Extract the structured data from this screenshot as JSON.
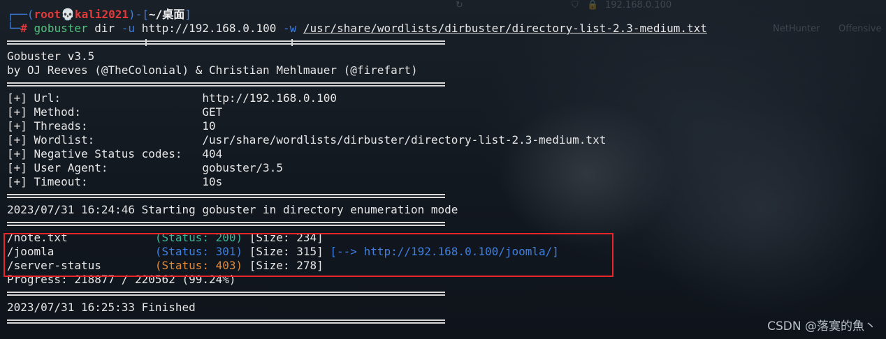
{
  "prompt": {
    "lead1": "┌──(",
    "user": "root",
    "skull": "💀",
    "host": "kali2021",
    "mid": ")-[",
    "cwd": "~/桌面",
    "end": "]",
    "lead2": "└─",
    "hash": "#",
    "cmd": "gobuster",
    "sub": "dir",
    "flag_u": "-u",
    "url": "http://192.168.0.100",
    "flag_w": "-w",
    "wordlist": "/usr/share/wordlists/dirbuster/directory-list-2.3-medium.txt"
  },
  "banner": {
    "line1": "Gobuster v3.5",
    "line2": "by OJ Reeves (@TheColonial) & Christian Mehlmauer (@firefart)"
  },
  "config": [
    {
      "key": "[+] Url:",
      "value": "http://192.168.0.100"
    },
    {
      "key": "[+] Method:",
      "value": "GET"
    },
    {
      "key": "[+] Threads:",
      "value": "10"
    },
    {
      "key": "[+] Wordlist:",
      "value": "/usr/share/wordlists/dirbuster/directory-list-2.3-medium.txt"
    },
    {
      "key": "[+] Negative Status codes:",
      "value": "404"
    },
    {
      "key": "[+] User Agent:",
      "value": "gobuster/3.5"
    },
    {
      "key": "[+] Timeout:",
      "value": "10s"
    }
  ],
  "start_line": "2023/07/31 16:24:46 Starting gobuster in directory enumeration mode",
  "results": [
    {
      "path": "/note.txt",
      "status": "(Status: 200)",
      "size": "[Size: 234]",
      "redirect": ""
    },
    {
      "path": "/joomla",
      "status": "(Status: 301)",
      "size": "[Size: 315]",
      "redirect": "[--> http://192.168.0.100/joomla/]"
    },
    {
      "path": "/server-status",
      "status": "(Status: 403)",
      "size": "[Size: 278]",
      "redirect": ""
    }
  ],
  "progress": "Progress: 218877 / 220562 (99.24%)",
  "finished_line": "2023/07/31 16:25:33 Finished",
  "watermark": "CSDN @落寞的魚丶",
  "colors": {
    "status_200": "#3fb79a",
    "status_301": "#3f7fe0",
    "status_403": "#e08a3a",
    "highlight_border": "#e8262a",
    "prompt_user": "#e03a3a",
    "command": "#4fc37e"
  },
  "browser_topbar": {
    "address": "192.168.0.100",
    "bookmark_nethunter": "NetHunter",
    "bookmark_offensive": "Offensive"
  }
}
